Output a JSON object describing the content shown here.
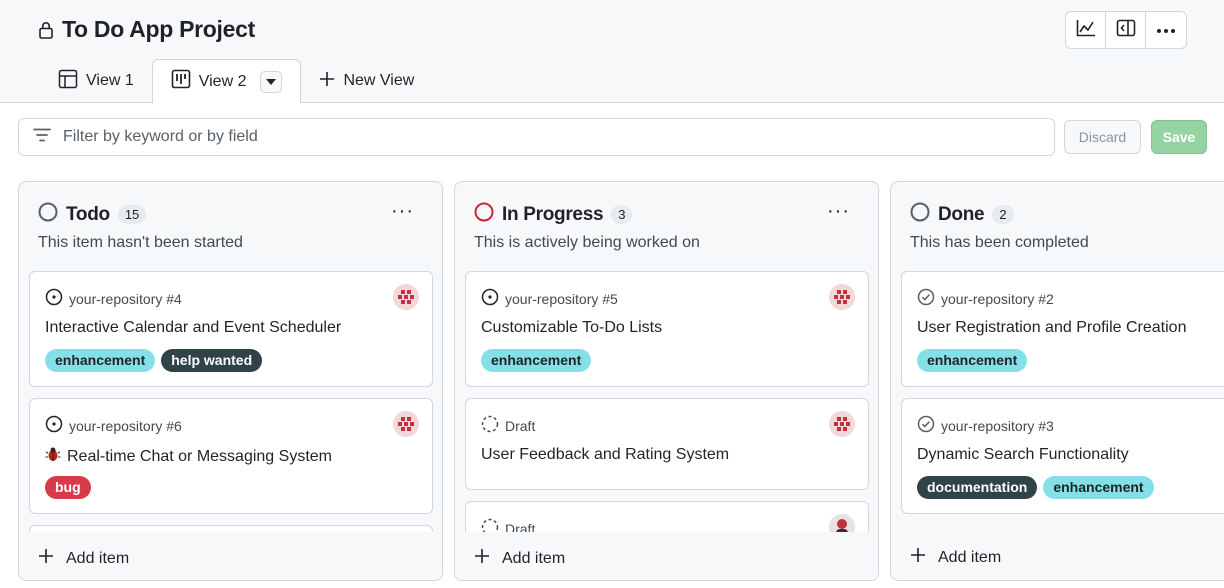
{
  "header": {
    "title": "To Do App Project",
    "actions": [
      "insights-icon",
      "side-panel-icon",
      "more-icon"
    ]
  },
  "tabs": [
    {
      "label": "View 1",
      "icon": "table-icon",
      "active": false
    },
    {
      "label": "View 2",
      "icon": "board-icon",
      "active": true
    },
    {
      "label": "New View",
      "icon": "plus-icon",
      "active": false
    }
  ],
  "filter": {
    "placeholder": "Filter by keyword or by field"
  },
  "buttons": {
    "discard": "Discard",
    "save": "Save"
  },
  "colors": {
    "enhancement_bg": "#84e0e6",
    "help_wanted_bg": "#2f4348",
    "bug_bg": "#d73a4a",
    "documentation_bg": "#2f4348",
    "in_progress_ring": "#d1242f",
    "save_bg": "#94d3a2"
  },
  "columns": [
    {
      "name": "Todo",
      "count": "15",
      "description": "This item hasn't been started",
      "add_label": "Add item",
      "cards": [
        {
          "meta": "your-repository #4",
          "title": "Interactive Calendar and Event Scheduler",
          "labels": [
            "enhancement",
            "help wanted"
          ]
        },
        {
          "meta": "your-repository #6",
          "title": "Real-time Chat or Messaging System",
          "labels": [
            "bug"
          ]
        }
      ]
    },
    {
      "name": "In Progress",
      "count": "3",
      "description": "This is actively being worked on",
      "add_label": "Add item",
      "cards": [
        {
          "meta": "your-repository #5",
          "title": "Customizable To-Do Lists",
          "labels": [
            "enhancement"
          ]
        },
        {
          "meta": "Draft",
          "title": "User Feedback and Rating System",
          "labels": []
        },
        {
          "meta": "Draft",
          "title": "",
          "labels": []
        }
      ]
    },
    {
      "name": "Done",
      "count": "2",
      "description": "This has been completed",
      "add_label": "Add item",
      "cards": [
        {
          "meta": "your-repository #2",
          "title": "User Registration and Profile Creation",
          "labels": [
            "enhancement"
          ]
        },
        {
          "meta": "your-repository #3",
          "title": "Dynamic Search Functionality",
          "labels": [
            "documentation",
            "enhancement"
          ]
        }
      ]
    }
  ]
}
